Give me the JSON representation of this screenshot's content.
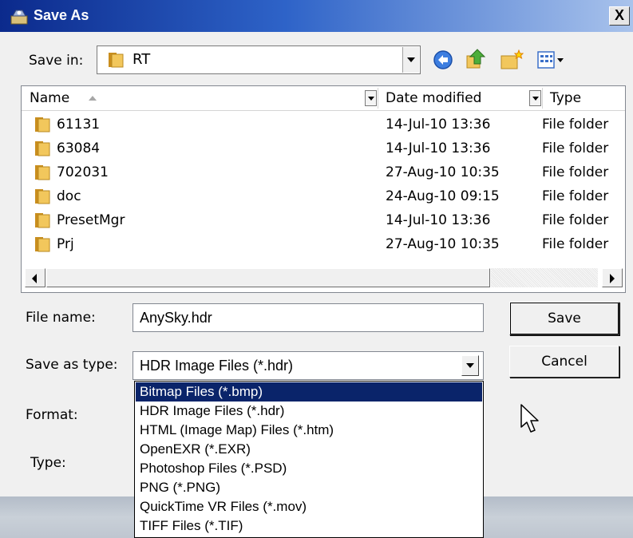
{
  "window": {
    "title": "Save As",
    "close_glyph": "X"
  },
  "save_in": {
    "label": "Save in:",
    "value": "RT"
  },
  "toolbar_icons": [
    "back-icon",
    "up-folder-icon",
    "new-folder-icon",
    "views-menu-icon"
  ],
  "file_list": {
    "columns": [
      "Name",
      "Date modified",
      "Type"
    ],
    "rows": [
      {
        "name": "61131",
        "date": "14-Jul-10 13:36",
        "type": "File folder"
      },
      {
        "name": "63084",
        "date": "14-Jul-10 13:36",
        "type": "File folder"
      },
      {
        "name": "702031",
        "date": "27-Aug-10 10:35",
        "type": "File folder"
      },
      {
        "name": "doc",
        "date": "24-Aug-10 09:15",
        "type": "File folder"
      },
      {
        "name": "PresetMgr",
        "date": "14-Jul-10 13:36",
        "type": "File folder"
      },
      {
        "name": "Prj",
        "date": "27-Aug-10 10:35",
        "type": "File folder"
      }
    ]
  },
  "file_name": {
    "label": "File name:",
    "value": "AnySky.hdr"
  },
  "save_as_type": {
    "label": "Save as type:",
    "value": "HDR Image Files (*.hdr)",
    "options": [
      "Bitmap Files (*.bmp)",
      "HDR Image Files (*.hdr)",
      "HTML (Image Map) Files (*.htm)",
      "OpenEXR (*.EXR)",
      "Photoshop Files (*.PSD)",
      "PNG (*.PNG)",
      "QuickTime VR Files (*.mov)",
      "TIFF Files (*.TIF)"
    ],
    "highlighted_option": "Bitmap Files (*.bmp)"
  },
  "format": {
    "label": "Format:"
  },
  "type": {
    "label": "Type:"
  },
  "buttons": {
    "save": "Save",
    "cancel": "Cancel"
  },
  "colors": {
    "title_bar": "#0b2a8c",
    "selection": "#0a246a",
    "folder": "#e8b64a"
  }
}
